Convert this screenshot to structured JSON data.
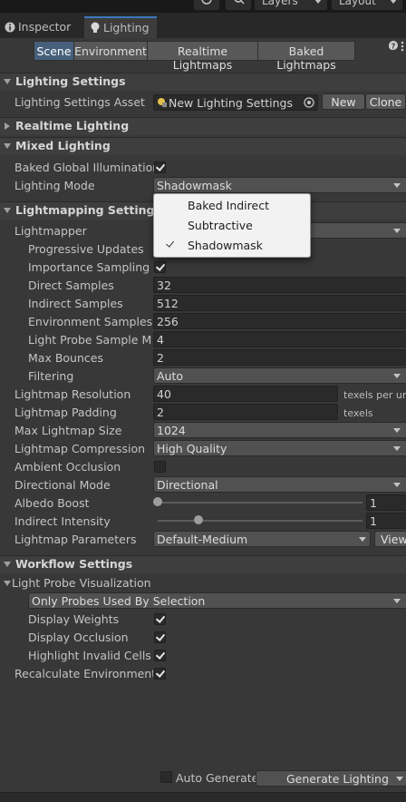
{
  "toolbar": {
    "layers_label": "Layers",
    "layout_label": "Layout"
  },
  "tabs": [
    {
      "label": "Inspector",
      "icon": "info-icon"
    },
    {
      "label": "Lighting",
      "icon": "lightbulb-icon",
      "active": true
    }
  ],
  "subtabs": [
    "Scene",
    "Environment",
    "Realtime Lightmaps",
    "Baked Lightmaps"
  ],
  "selected_subtab": "Scene",
  "lighting_settings": {
    "title": "Lighting Settings",
    "asset_label": "Lighting Settings Asset",
    "asset_value": "New Lighting Settings",
    "new_button": "New",
    "clone_button": "Clone"
  },
  "realtime_lighting": {
    "title": "Realtime Lighting"
  },
  "mixed_lighting": {
    "title": "Mixed Lighting",
    "baked_gi_label": "Baked Global Illumination",
    "baked_gi_checked": true,
    "lighting_mode_label": "Lighting Mode",
    "lighting_mode_value": "Shadowmask"
  },
  "popup": {
    "options": [
      "Baked Indirect",
      "Subtractive",
      "Shadowmask"
    ],
    "selected": "Shadowmask"
  },
  "lightmapping": {
    "title": "Lightmapping Settings",
    "lightmapper_label": "Lightmapper",
    "progressive_updates_label": "Progressive Updates",
    "importance_sampling_label": "Importance Sampling",
    "importance_sampling_checked": true,
    "direct_samples_label": "Direct Samples",
    "direct_samples": "32",
    "indirect_samples_label": "Indirect Samples",
    "indirect_samples": "512",
    "environment_samples_label": "Environment Samples",
    "environment_samples": "256",
    "light_probe_mult_label": "Light Probe Sample Mult",
    "light_probe_mult": "4",
    "max_bounces_label": "Max Bounces",
    "max_bounces": "2",
    "filtering_label": "Filtering",
    "filtering_value": "Auto",
    "resolution_label": "Lightmap Resolution",
    "resolution_value": "40",
    "resolution_unit": "texels per unit",
    "padding_label": "Lightmap Padding",
    "padding_value": "2",
    "padding_unit": "texels",
    "max_size_label": "Max Lightmap Size",
    "max_size_value": "1024",
    "compression_label": "Lightmap Compression",
    "compression_value": "High Quality",
    "ao_label": "Ambient Occlusion",
    "ao_checked": false,
    "directional_label": "Directional Mode",
    "directional_value": "Directional",
    "albedo_label": "Albedo Boost",
    "albedo_value": "1",
    "albedo_fraction": 0.0,
    "indirect_label": "Indirect Intensity",
    "indirect_value": "1",
    "indirect_fraction": 0.2,
    "params_label": "Lightmap Parameters",
    "params_value": "Default-Medium",
    "view_button": "View"
  },
  "workflow": {
    "title": "Workflow Settings",
    "probe_vis_label": "Light Probe Visualization",
    "probe_vis_value": "Only Probes Used By Selection",
    "display_weights_label": "Display Weights",
    "display_weights_checked": true,
    "display_occlusion_label": "Display Occlusion",
    "display_occlusion_checked": true,
    "highlight_invalid_label": "Highlight Invalid Cells",
    "highlight_invalid_checked": true,
    "recalc_env_label": "Recalculate Environment Li",
    "recalc_env_checked": true
  },
  "footer": {
    "auto_generate_label": "Auto Generate",
    "auto_generate_checked": false,
    "generate_button": "Generate Lighting"
  },
  "colors": {
    "accent": "#3a79bb",
    "panel_bg": "#383838",
    "popup_bg": "#f2f2f2"
  }
}
